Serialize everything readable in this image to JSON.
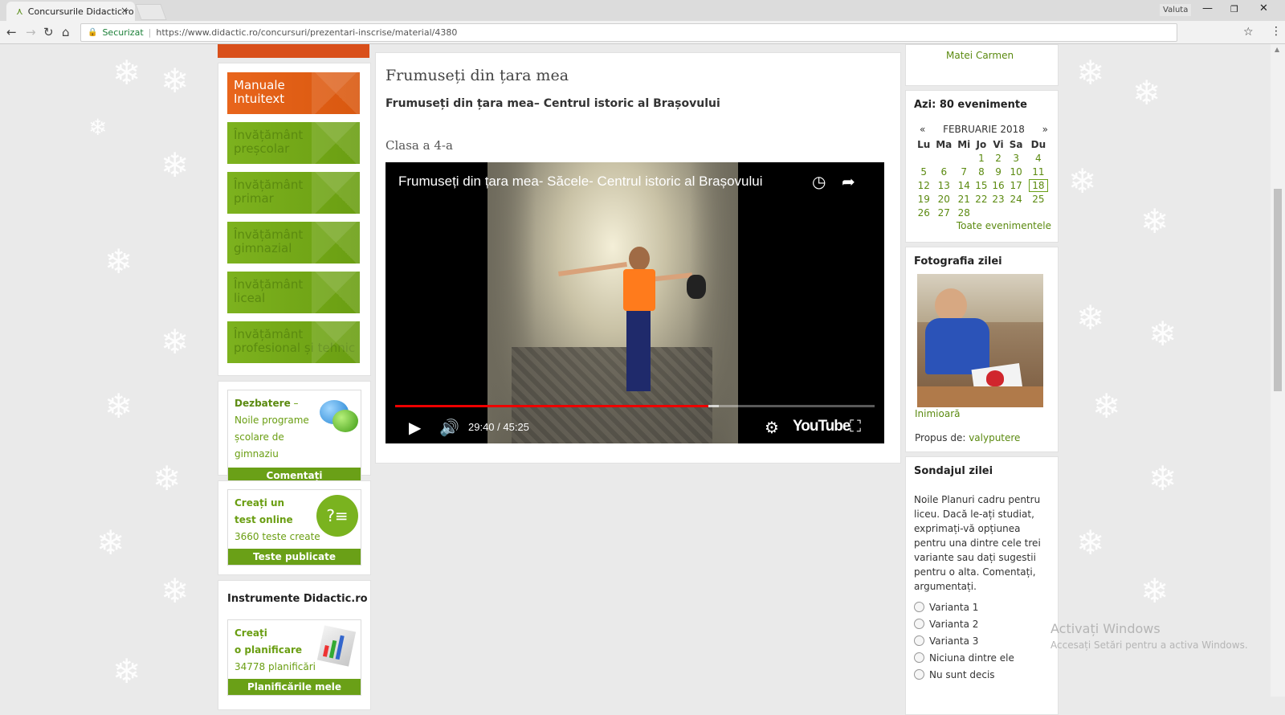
{
  "browser": {
    "tab_title": "Concursurile Didactic.ro",
    "tab_close": "×",
    "profile": "Valuta",
    "secure_label": "Securizat",
    "url": "https://www.didactic.ro/concursuri/prezentari-inscrise/material/4380"
  },
  "left_menu": [
    {
      "line1": "Manuale",
      "line2": "Intuitext",
      "color": "#e0611b"
    },
    {
      "line1": "Învățământ",
      "line2": "preșcolar",
      "color": "#77aa19"
    },
    {
      "line1": "Învățământ",
      "line2": "primar",
      "color": "#77aa19"
    },
    {
      "line1": "Învățământ",
      "line2": "gimnazial",
      "color": "#77aa19"
    },
    {
      "line1": "Învățământ",
      "line2": "liceal",
      "color": "#77aa19"
    },
    {
      "line1": "Învățământ",
      "line2": "profesional și tehnic",
      "color": "#77aa19"
    }
  ],
  "debate": {
    "bold": "Dezbatere",
    "text": " – Noile programe școlare de gimnaziu",
    "button": "Comentați"
  },
  "tests": {
    "line1": "Creați un",
    "line2": "test online",
    "count": "3660 teste create",
    "button": "Teste publicate"
  },
  "tools": {
    "title": "Instrumente Didactic.ro",
    "line1": "Creați",
    "line2": "o planificare",
    "count": "34778 planificări",
    "button": "Planificările mele"
  },
  "main": {
    "heading": "Frumuseți din țara mea",
    "subheading": "Frumuseți din țara mea– Centrul istoric al Brașovului",
    "class_label": "Clasa a 4-a",
    "video": {
      "title": "Frumuseți din țara mea- Săcele- Centrul istoric al Brașovului",
      "time": "29:40 / 45:25",
      "played_fraction": 0.653,
      "buffered_fraction": 0.675,
      "brand": "YouTube"
    }
  },
  "right": {
    "top_name": "Matei Carmen",
    "events_label": "Azi: ",
    "events_count": "80 evenimente",
    "calendar": {
      "prev": "«",
      "month": "FEBRUARIE 2018",
      "next": "»",
      "days": [
        "Lu",
        "Ma",
        "Mi",
        "Jo",
        "Vi",
        "Sa",
        "Du"
      ],
      "weeks": [
        [
          "",
          "",
          "",
          "1",
          "2",
          "3",
          "4"
        ],
        [
          "5",
          "6",
          "7",
          "8",
          "9",
          "10",
          "11"
        ],
        [
          "12",
          "13",
          "14",
          "15",
          "16",
          "17",
          "18"
        ],
        [
          "19",
          "20",
          "21",
          "22",
          "23",
          "24",
          "25"
        ],
        [
          "26",
          "27",
          "28",
          "",
          "",
          "",
          ""
        ]
      ],
      "today": "18",
      "all_events": "Toate evenimentele"
    },
    "photo": {
      "title": "Fotografia zilei",
      "caption": "Inimioară",
      "proposed_label": "Propus de: ",
      "author": "valyputere"
    },
    "poll": {
      "title": "Sondajul zilei",
      "question": "Noile Planuri cadru pentru liceu. Dacă le-ați studiat, exprimați-vă opțiunea pentru una dintre cele trei variante sau dați sugestii pentru o alta. Comentați, argumentați.",
      "options": [
        "Varianta 1",
        "Varianta 2",
        "Varianta 3",
        "Niciuna dintre ele",
        "Nu sunt decis"
      ]
    }
  },
  "watermark": {
    "line1": "Activați Windows",
    "line2": "Accesați Setări pentru a activa Windows."
  }
}
